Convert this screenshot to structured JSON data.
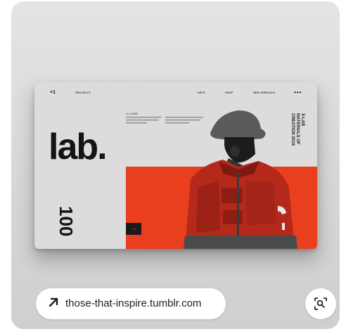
{
  "mockup": {
    "logo": "+1",
    "nav": {
      "projects": "PROJECTS",
      "item1": "ARTS",
      "item2": "SHOP",
      "item3": "NEW ARRIVALS",
      "menu_dots": "•••"
    },
    "headline": "lab.",
    "vertical_number": "100",
    "intro_title": "X-LAB8",
    "vertical_title": "X-LAB\nMATERIALS OF\nCREATION 2019",
    "arrow": "→"
  },
  "source_link": {
    "label": "those-that-inspire.tumblr.com",
    "icon": "arrow-up-right-icon"
  },
  "lens_button": {
    "icon": "visual-search-icon"
  },
  "colors": {
    "accent": "#ea3f1f",
    "card_bg": "#d9d9d9",
    "text_dark": "#141414"
  }
}
